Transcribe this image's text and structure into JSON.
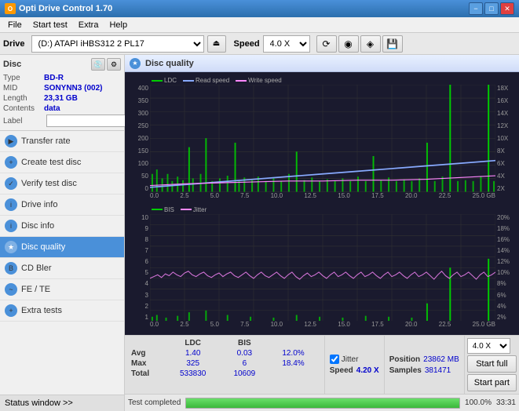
{
  "app": {
    "title": "Opti Drive Control 1.70",
    "icon": "O"
  },
  "titlebar": {
    "minimize_label": "−",
    "maximize_label": "□",
    "close_label": "✕"
  },
  "menubar": {
    "items": [
      "File",
      "Start test",
      "Extra",
      "Help"
    ]
  },
  "drivebar": {
    "drive_label": "Drive",
    "drive_value": "(D:) ATAPI iHBS312  2 PL17",
    "speed_label": "Speed",
    "speed_value": "4.0 X"
  },
  "disc": {
    "title": "Disc",
    "type_label": "Type",
    "type_value": "BD-R",
    "mid_label": "MID",
    "mid_value": "SONYNN3 (002)",
    "length_label": "Length",
    "length_value": "23,31 GB",
    "contents_label": "Contents",
    "contents_value": "data",
    "label_label": "Label",
    "label_value": ""
  },
  "nav": {
    "items": [
      {
        "id": "transfer-rate",
        "label": "Transfer rate",
        "active": false
      },
      {
        "id": "create-test-disc",
        "label": "Create test disc",
        "active": false
      },
      {
        "id": "verify-test-disc",
        "label": "Verify test disc",
        "active": false
      },
      {
        "id": "drive-info",
        "label": "Drive info",
        "active": false
      },
      {
        "id": "disc-info",
        "label": "Disc info",
        "active": false
      },
      {
        "id": "disc-quality",
        "label": "Disc quality",
        "active": true
      },
      {
        "id": "cd-bler",
        "label": "CD Bler",
        "active": false
      },
      {
        "id": "fe-te",
        "label": "FE / TE",
        "active": false
      },
      {
        "id": "extra-tests",
        "label": "Extra tests",
        "active": false
      }
    ]
  },
  "status_window": {
    "label": "Status window >>"
  },
  "quality": {
    "title": "Disc quality"
  },
  "chart1": {
    "legend": [
      {
        "label": "LDC",
        "color": "#00cc00"
      },
      {
        "label": "Read speed",
        "color": "#88aaff"
      },
      {
        "label": "Write speed",
        "color": "#ff88ff"
      }
    ],
    "y_left": [
      "400",
      "350",
      "300",
      "250",
      "200",
      "150",
      "100",
      "50",
      "0"
    ],
    "y_right": [
      "18X",
      "16X",
      "14X",
      "12X",
      "10X",
      "8X",
      "6X",
      "4X",
      "2X"
    ],
    "x_ticks": [
      "0.0",
      "2.5",
      "5.0",
      "7.5",
      "10.0",
      "12.5",
      "15.0",
      "17.5",
      "20.0",
      "22.5",
      "25.0 GB"
    ]
  },
  "chart2": {
    "legend": [
      {
        "label": "BIS",
        "color": "#00cc00"
      },
      {
        "label": "Jitter",
        "color": "#ff88ff"
      }
    ],
    "y_left": [
      "10",
      "9",
      "8",
      "7",
      "6",
      "5",
      "4",
      "3",
      "2",
      "1"
    ],
    "y_right": [
      "20%",
      "18%",
      "16%",
      "14%",
      "12%",
      "10%",
      "8%",
      "6%",
      "4%",
      "2%"
    ],
    "x_ticks": [
      "0.0",
      "2.5",
      "5.0",
      "7.5",
      "10.0",
      "12.5",
      "15.0",
      "17.5",
      "20.0",
      "22.5",
      "25.0 GB"
    ]
  },
  "stats": {
    "headers": [
      "LDC",
      "BIS"
    ],
    "jitter_label": "Jitter",
    "jitter_checked": true,
    "speed_label": "Speed",
    "speed_value": "4.20 X",
    "speed_select": "4.0 X",
    "rows": [
      {
        "label": "Avg",
        "ldc": "1.40",
        "bis": "0.03",
        "jitter": "12.0%"
      },
      {
        "label": "Max",
        "ldc": "325",
        "bis": "6",
        "jitter": "18.4%"
      },
      {
        "label": "Total",
        "ldc": "533830",
        "bis": "10609",
        "jitter": ""
      }
    ],
    "position_label": "Position",
    "position_value": "23862 MB",
    "samples_label": "Samples",
    "samples_value": "381471",
    "start_full_label": "Start full",
    "start_part_label": "Start part"
  },
  "progress": {
    "status_text": "Test completed",
    "percent": 100,
    "percent_label": "100.0%",
    "time": "33:31"
  }
}
